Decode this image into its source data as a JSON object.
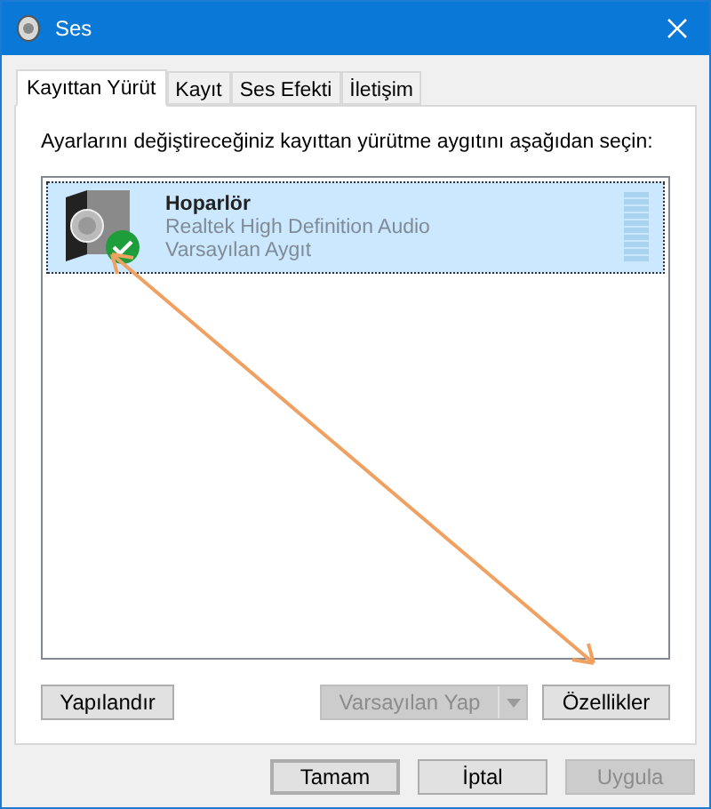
{
  "window": {
    "title": "Ses"
  },
  "tabs": [
    {
      "label": "Kayıttan Yürüt",
      "selected": true
    },
    {
      "label": "Kayıt",
      "selected": false
    },
    {
      "label": "Ses Efekti",
      "selected": false
    },
    {
      "label": "İletişim",
      "selected": false
    }
  ],
  "instruction": "Ayarlarını değiştireceğiniz kayıttan yürütme aygıtını aşağıdan seçin:",
  "devices": [
    {
      "name": "Hoparlör",
      "driver": "Realtek High Definition Audio",
      "status": "Varsayılan Aygıt",
      "selected": true,
      "is_default": true
    }
  ],
  "panel_buttons": [
    {
      "kind": "plain",
      "label": "Yapılandır",
      "disabled": false
    },
    {
      "kind": "split",
      "label": "Varsayılan Yap",
      "disabled": true
    },
    {
      "kind": "plain",
      "label": "Özellikler",
      "disabled": false
    }
  ],
  "dialog_buttons": [
    {
      "label": "Tamam",
      "disabled": false,
      "default": true
    },
    {
      "label": "İptal",
      "disabled": false,
      "default": false
    },
    {
      "label": "Uygula",
      "disabled": true,
      "default": false
    }
  ]
}
